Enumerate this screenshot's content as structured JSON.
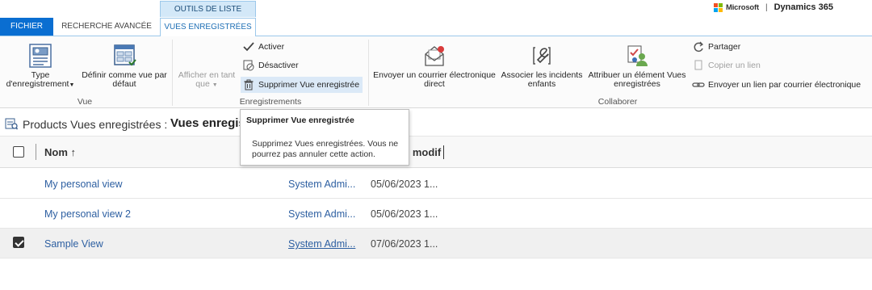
{
  "tabs": {
    "context_group": "OUTILS DE LISTE",
    "fichier": "FICHIER",
    "recherche": "RECHERCHE AVANCÉE",
    "vues": "VUES ENREGISTRÉES"
  },
  "brand": {
    "microsoft": "Microsoft",
    "separator": "|",
    "dynamics": "Dynamics 365",
    "logo_colors": [
      "#f25022",
      "#7fba00",
      "#00a4ef",
      "#ffb900"
    ]
  },
  "ribbon": {
    "vue": {
      "type_label_1": "Type",
      "type_label_2": "d'enregistrement",
      "default_label_1": "Définir comme vue par",
      "default_label_2": "défaut",
      "group": "Vue"
    },
    "enregistrements": {
      "afficher_1": "Afficher en tant",
      "afficher_2": "que",
      "activer": "Activer",
      "desactiver": "Désactiver",
      "supprimer": "Supprimer Vue enregistrée",
      "group": "Enregistrements"
    },
    "collaborer": {
      "email_1": "Envoyer un courrier électronique",
      "email_2": "direct",
      "associer_1": "Associer les incidents",
      "associer_2": "enfants",
      "attribuer_1": "Attribuer un élément Vues",
      "attribuer_2": "enregistrées",
      "partager": "Partager",
      "copier": "Copier un lien",
      "envoyer_lien": "Envoyer un lien par courrier électronique",
      "group": "Collaborer"
    }
  },
  "grid": {
    "entity": "Products Vues enregistrées :",
    "view_name": "Vues enregis",
    "col_name": "Nom ↑",
    "col_modified": "e modif",
    "rows": [
      {
        "name": "My personal view",
        "owner": "System Admi...",
        "date": "05/06/2023 1...",
        "checked": false
      },
      {
        "name": "My personal view 2",
        "owner": "System Admi...",
        "date": "05/06/2023 1...",
        "checked": false
      },
      {
        "name": "Sample View",
        "owner": "System Admi...",
        "date": "07/06/2023 1...",
        "checked": true
      }
    ]
  },
  "tooltip": {
    "title": "Supprimer Vue enregistrée",
    "body": "Supprimez Vues enregistrées. Vous ne pourrez pas annuler cette action."
  }
}
